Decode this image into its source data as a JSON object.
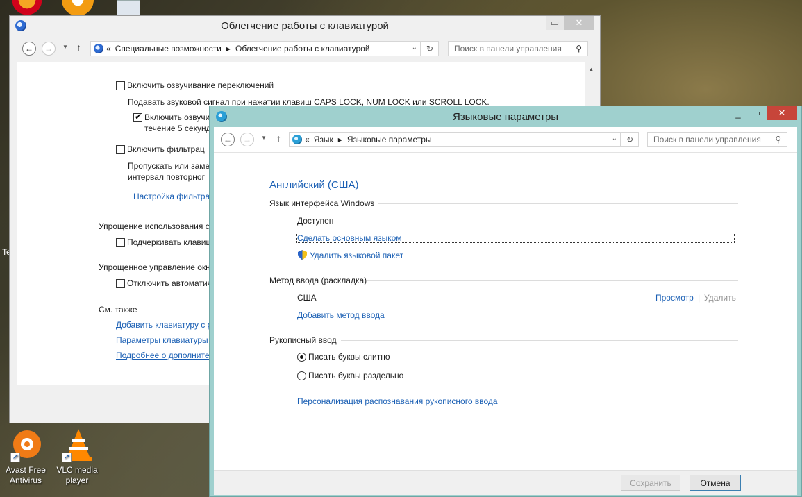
{
  "desktop": {
    "icons": [
      {
        "label_line1": "Avast Free",
        "label_line2": "Antivirus"
      },
      {
        "label_line1": "VLC media",
        "label_line2": "player"
      }
    ]
  },
  "back_window": {
    "title": "Облегчение работы с клавиатурой",
    "breadcrumb_prefix": "«",
    "breadcrumb_1": "Специальные возможности",
    "breadcrumb_2": "Облегчение работы с клавиатурой",
    "search_placeholder": "Поиск в панели управления",
    "toggle_keys_label": "Включить озвучивание переключений",
    "toggle_keys_desc": "Подавать звуковой сигнал при нажатии клавиш CAPS LOCK, NUM LOCK или SCROLL LOCK.",
    "toggle_keys_sub_label_1": "Включить озвучи",
    "toggle_keys_sub_label_2": "течение 5 секунд",
    "filter_keys_label": "Включить фильтрац",
    "filter_keys_desc_1": "Пропускать или заме",
    "filter_keys_desc_2": "интервал повторног",
    "filter_settings_link": "Настройка фильтра",
    "section_simplify": "Упрощение использования с",
    "underline_label": "Подчеркивать клавиш",
    "section_window_mgmt": "Упрощенное управление окн",
    "disable_auto_label": "Отключить автоматич",
    "see_also": "См. также",
    "link_add_keyboard": "Добавить клавиатуру с р",
    "link_keyboard_params": "Параметры клавиатуры",
    "link_more_info": "Подробнее о дополните"
  },
  "front_window": {
    "title": "Языковые параметры",
    "breadcrumb_prefix": "«",
    "breadcrumb_1": "Язык",
    "breadcrumb_2": "Языковые параметры",
    "search_placeholder": "Поиск в панели управления",
    "language_heading": "Английский (США)",
    "section_ui_language": "Язык интерфейса Windows",
    "ui_status": "Доступен",
    "make_primary_link": "Сделать основным языком",
    "remove_pack_link": "Удалить языковой пакет",
    "section_input_method": "Метод ввода (раскладка)",
    "input_method_name": "США",
    "preview_link": "Просмотр",
    "separator": "|",
    "remove_link": "Удалить",
    "add_input_link": "Добавить метод ввода",
    "section_handwriting": "Рукописный ввод",
    "radio_connected": "Писать буквы слитно",
    "radio_separate": "Писать буквы раздельно",
    "handwriting_personalize_link": "Персонализация распознавания рукописного ввода",
    "save_button": "Сохранить",
    "cancel_button": "Отмена"
  },
  "colors": {
    "link": "#1a5fb4",
    "front_frame": "#9fd0ce",
    "close_button": "#c7453a"
  }
}
